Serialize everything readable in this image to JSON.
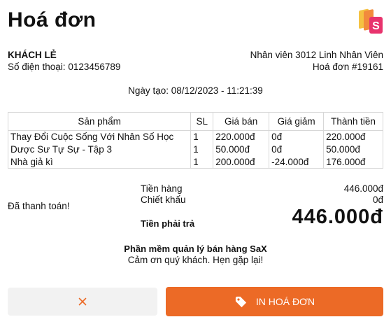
{
  "header": {
    "title": "Hoá đơn",
    "logo_icon": "sax-logo-icon",
    "logo_letter": "S"
  },
  "customer": {
    "name": "KHÁCH LẺ",
    "phone": "Số điện thoại: 0123456789"
  },
  "staff": {
    "staff_line": "Nhân viên 3012 Linh Nhân Viên",
    "invoice_line": "Hoá đơn #19161"
  },
  "created_at": "Ngày tạo: 08/12/2023 - 11:21:39",
  "table": {
    "headers": [
      "Sản phẩm",
      "SL",
      "Giá bán",
      "Giá giảm",
      "Thành tiền"
    ],
    "rows": [
      [
        "Thay Đổi Cuộc Sống Với Nhân Số Học",
        "1",
        "220.000đ",
        "0đ",
        "220.000đ"
      ],
      [
        "Dược Sư Tự Sự - Tập 3",
        "1",
        "50.000đ",
        "0đ",
        "50.000đ"
      ],
      [
        "Nhà giả kì",
        "1",
        "200.000đ",
        "-24.000đ",
        "176.000đ"
      ]
    ]
  },
  "summary": {
    "paid_label": "Đã thanh toán!",
    "subtotal_label": "Tiền hàng",
    "subtotal_value": "446.000đ",
    "discount_label": "Chiết khấu",
    "discount_value": "0đ",
    "total_label": "Tiền phải trả",
    "total_value": "446.000đ"
  },
  "footer": {
    "line1": "Phần mềm quản lý bán hàng SaX",
    "line2": "Cảm ơn quý khách. Hẹn gặp lại!"
  },
  "buttons": {
    "cancel_icon": "close-icon",
    "print_icon": "tag-icon",
    "print_label": "IN HOÁ ĐƠN"
  },
  "colors": {
    "accent": "#ec6a26",
    "logo_pink": "#e8336d",
    "logo_yellow": "#f5c242",
    "logo_orange": "#f28b3c"
  }
}
